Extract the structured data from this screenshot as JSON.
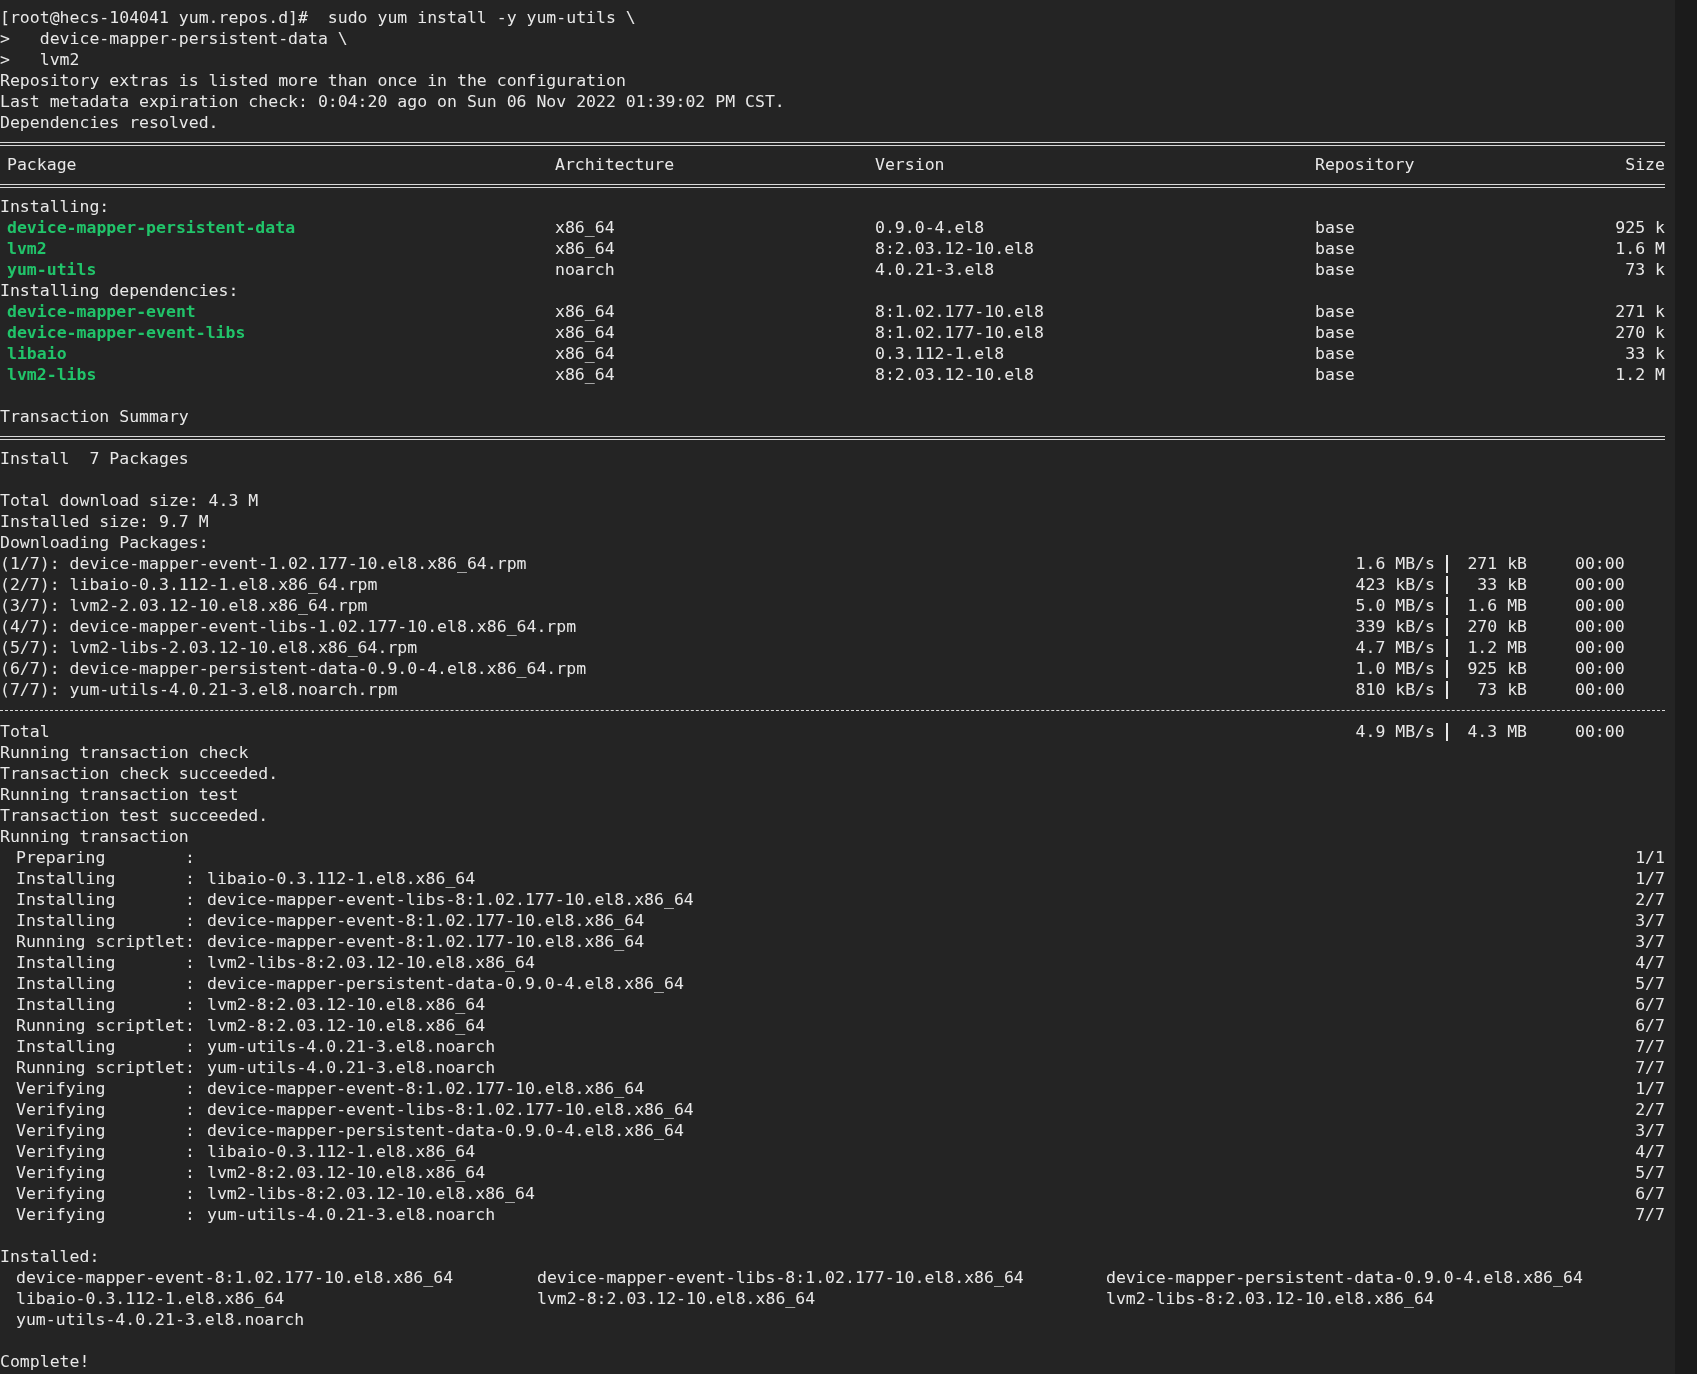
{
  "terminal": {
    "lines": [
      {
        "kind": "text",
        "text": "[root@hecs-104041 yum.repos.d]#  sudo yum install -y yum-utils \\"
      },
      {
        "kind": "text",
        "text": ">   device-mapper-persistent-data \\"
      },
      {
        "kind": "text",
        "text": ">   lvm2"
      },
      {
        "kind": "text",
        "text": "Repository extras is listed more than once in the configuration"
      },
      {
        "kind": "text",
        "text": "Last metadata expiration check: 0:04:20 ago on Sun 06 Nov 2022 01:39:02 PM CST."
      },
      {
        "kind": "text",
        "text": "Dependencies resolved."
      },
      {
        "kind": "double_rule"
      },
      {
        "kind": "header",
        "columns": [
          "Package",
          "Architecture",
          "Version",
          "Repository",
          "Size"
        ]
      },
      {
        "kind": "double_rule"
      },
      {
        "kind": "text",
        "text": "Installing:"
      },
      {
        "kind": "package",
        "name": "device-mapper-persistent-data",
        "arch": "x86_64",
        "version": "0.9.0-4.el8",
        "repo": "base",
        "size": "925 k"
      },
      {
        "kind": "package",
        "name": "lvm2",
        "arch": "x86_64",
        "version": "8:2.03.12-10.el8",
        "repo": "base",
        "size": "1.6 M"
      },
      {
        "kind": "package",
        "name": "yum-utils",
        "arch": "noarch",
        "version": "4.0.21-3.el8",
        "repo": "base",
        "size": "73 k"
      },
      {
        "kind": "text",
        "text": "Installing dependencies:"
      },
      {
        "kind": "package",
        "name": "device-mapper-event",
        "arch": "x86_64",
        "version": "8:1.02.177-10.el8",
        "repo": "base",
        "size": "271 k"
      },
      {
        "kind": "package",
        "name": "device-mapper-event-libs",
        "arch": "x86_64",
        "version": "8:1.02.177-10.el8",
        "repo": "base",
        "size": "270 k"
      },
      {
        "kind": "package",
        "name": "libaio",
        "arch": "x86_64",
        "version": "0.3.112-1.el8",
        "repo": "base",
        "size": "33 k"
      },
      {
        "kind": "package",
        "name": "lvm2-libs",
        "arch": "x86_64",
        "version": "8:2.03.12-10.el8",
        "repo": "base",
        "size": "1.2 M"
      },
      {
        "kind": "blank"
      },
      {
        "kind": "text",
        "text": "Transaction Summary"
      },
      {
        "kind": "double_rule"
      },
      {
        "kind": "text",
        "text": "Install  7 Packages"
      },
      {
        "kind": "blank"
      },
      {
        "kind": "text",
        "text": "Total download size: 4.3 M"
      },
      {
        "kind": "text",
        "text": "Installed size: 9.7 M"
      },
      {
        "kind": "text",
        "text": "Downloading Packages:"
      },
      {
        "kind": "download",
        "file": "(1/7): device-mapper-event-1.02.177-10.el8.x86_64.rpm",
        "speed": "1.6 MB/s",
        "size": "271 kB",
        "time": "00:00"
      },
      {
        "kind": "download",
        "file": "(2/7): libaio-0.3.112-1.el8.x86_64.rpm",
        "speed": "423 kB/s",
        "size": "33 kB",
        "time": "00:00"
      },
      {
        "kind": "download",
        "file": "(3/7): lvm2-2.03.12-10.el8.x86_64.rpm",
        "speed": "5.0 MB/s",
        "size": "1.6 MB",
        "time": "00:00"
      },
      {
        "kind": "download",
        "file": "(4/7): device-mapper-event-libs-1.02.177-10.el8.x86_64.rpm",
        "speed": "339 kB/s",
        "size": "270 kB",
        "time": "00:00"
      },
      {
        "kind": "download",
        "file": "(5/7): lvm2-libs-2.03.12-10.el8.x86_64.rpm",
        "speed": "4.7 MB/s",
        "size": "1.2 MB",
        "time": "00:00"
      },
      {
        "kind": "download",
        "file": "(6/7): device-mapper-persistent-data-0.9.0-4.el8.x86_64.rpm",
        "speed": "1.0 MB/s",
        "size": "925 kB",
        "time": "00:00"
      },
      {
        "kind": "download",
        "file": "(7/7): yum-utils-4.0.21-3.el8.noarch.rpm",
        "speed": "810 kB/s",
        "size": "73 kB",
        "time": "00:00"
      },
      {
        "kind": "single_rule"
      },
      {
        "kind": "download",
        "file": "Total",
        "speed": "4.9 MB/s",
        "size": "4.3 MB",
        "time": "00:00"
      },
      {
        "kind": "text",
        "text": "Running transaction check"
      },
      {
        "kind": "text",
        "text": "Transaction check succeeded."
      },
      {
        "kind": "text",
        "text": "Running transaction test"
      },
      {
        "kind": "text",
        "text": "Transaction test succeeded."
      },
      {
        "kind": "text",
        "text": "Running transaction"
      },
      {
        "kind": "step",
        "action": "Preparing        :",
        "counter": "1/1"
      },
      {
        "kind": "step",
        "action": "Installing       :",
        "target": "libaio-0.3.112-1.el8.x86_64",
        "counter": "1/7"
      },
      {
        "kind": "step",
        "action": "Installing       :",
        "target": "device-mapper-event-libs-8:1.02.177-10.el8.x86_64",
        "counter": "2/7"
      },
      {
        "kind": "step",
        "action": "Installing       :",
        "target": "device-mapper-event-8:1.02.177-10.el8.x86_64",
        "counter": "3/7"
      },
      {
        "kind": "step",
        "action": "Running scriptlet:",
        "target": "device-mapper-event-8:1.02.177-10.el8.x86_64",
        "counter": "3/7"
      },
      {
        "kind": "step",
        "action": "Installing       :",
        "target": "lvm2-libs-8:2.03.12-10.el8.x86_64",
        "counter": "4/7"
      },
      {
        "kind": "step",
        "action": "Installing       :",
        "target": "device-mapper-persistent-data-0.9.0-4.el8.x86_64",
        "counter": "5/7"
      },
      {
        "kind": "step",
        "action": "Installing       :",
        "target": "lvm2-8:2.03.12-10.el8.x86_64",
        "counter": "6/7"
      },
      {
        "kind": "step",
        "action": "Running scriptlet:",
        "target": "lvm2-8:2.03.12-10.el8.x86_64",
        "counter": "6/7"
      },
      {
        "kind": "step",
        "action": "Installing       :",
        "target": "yum-utils-4.0.21-3.el8.noarch",
        "counter": "7/7"
      },
      {
        "kind": "step",
        "action": "Running scriptlet:",
        "target": "yum-utils-4.0.21-3.el8.noarch",
        "counter": "7/7"
      },
      {
        "kind": "step",
        "action": "Verifying        :",
        "target": "device-mapper-event-8:1.02.177-10.el8.x86_64",
        "counter": "1/7"
      },
      {
        "kind": "step",
        "action": "Verifying        :",
        "target": "device-mapper-event-libs-8:1.02.177-10.el8.x86_64",
        "counter": "2/7"
      },
      {
        "kind": "step",
        "action": "Verifying        :",
        "target": "device-mapper-persistent-data-0.9.0-4.el8.x86_64",
        "counter": "3/7"
      },
      {
        "kind": "step",
        "action": "Verifying        :",
        "target": "libaio-0.3.112-1.el8.x86_64",
        "counter": "4/7"
      },
      {
        "kind": "step",
        "action": "Verifying        :",
        "target": "lvm2-8:2.03.12-10.el8.x86_64",
        "counter": "5/7"
      },
      {
        "kind": "step",
        "action": "Verifying        :",
        "target": "lvm2-libs-8:2.03.12-10.el8.x86_64",
        "counter": "6/7"
      },
      {
        "kind": "step",
        "action": "Verifying        :",
        "target": "yum-utils-4.0.21-3.el8.noarch",
        "counter": "7/7"
      },
      {
        "kind": "blank"
      },
      {
        "kind": "text",
        "text": "Installed:"
      },
      {
        "kind": "installed",
        "items": [
          "device-mapper-event-8:1.02.177-10.el8.x86_64",
          "device-mapper-event-libs-8:1.02.177-10.el8.x86_64",
          "device-mapper-persistent-data-0.9.0-4.el8.x86_64"
        ]
      },
      {
        "kind": "installed",
        "items": [
          "libaio-0.3.112-1.el8.x86_64",
          "lvm2-8:2.03.12-10.el8.x86_64",
          "lvm2-libs-8:2.03.12-10.el8.x86_64"
        ]
      },
      {
        "kind": "installed",
        "items": [
          "yum-utils-4.0.21-3.el8.noarch"
        ]
      },
      {
        "kind": "blank"
      },
      {
        "kind": "text",
        "text": "Complete!"
      }
    ]
  }
}
